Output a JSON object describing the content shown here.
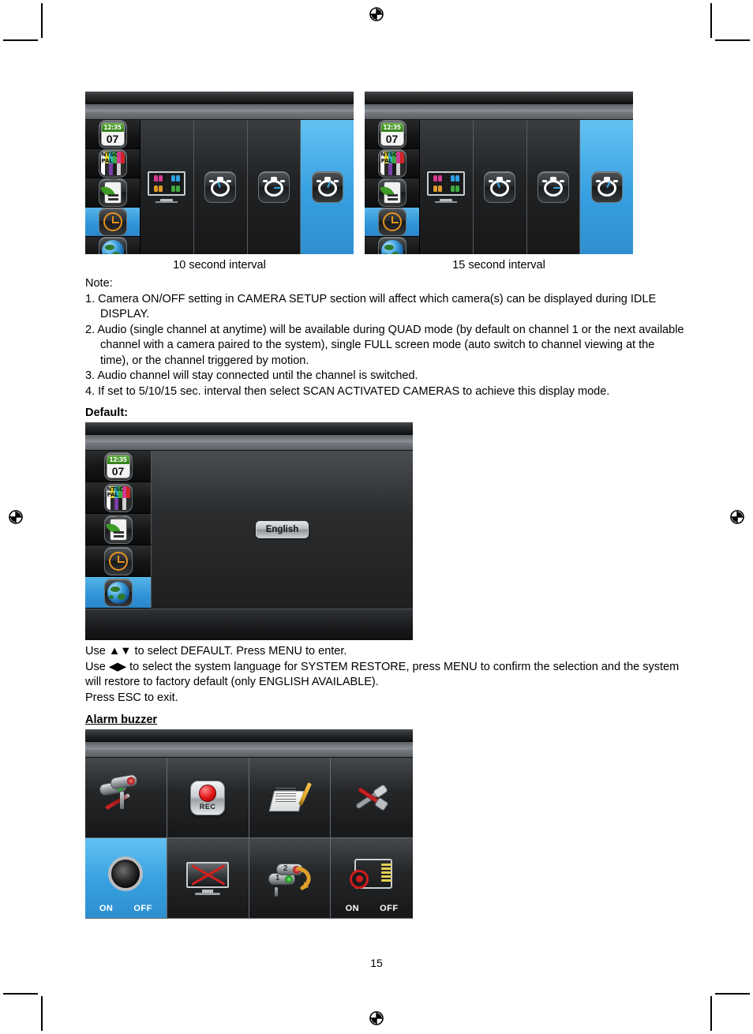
{
  "document": {
    "page_number": "15"
  },
  "idle_display": {
    "panels": [
      {
        "caption": "10 second interval",
        "selected_sidebar_index": 3,
        "selected_column_index": 3,
        "sidebar_icons": [
          "calendar-clock-icon",
          "ntsc-pal-icon",
          "eco-battery-icon",
          "orange-clock-icon",
          "globe-icon"
        ],
        "columns": [
          "quad-monitor-icon",
          "stopwatch-5s-icon",
          "stopwatch-10s-icon",
          "stopwatch-15s-icon"
        ],
        "clock": {
          "time": "12:35",
          "day": "07"
        }
      },
      {
        "caption": "15 second interval",
        "selected_sidebar_index": 3,
        "selected_column_index": 4,
        "sidebar_icons": [
          "calendar-clock-icon",
          "ntsc-pal-icon",
          "eco-battery-icon",
          "orange-clock-icon",
          "globe-icon"
        ],
        "columns": [
          "quad-monitor-icon",
          "stopwatch-5s-icon",
          "stopwatch-10s-icon",
          "stopwatch-15s-icon"
        ],
        "clock": {
          "time": "12:35",
          "day": "07"
        }
      }
    ]
  },
  "note": {
    "heading": "Note:",
    "items": [
      "1. Camera ON/OFF setting in CAMERA SETUP section will affect which camera(s) can be displayed during IDLE DISPLAY.",
      "2. Audio (single channel at anytime) will be available during QUAD mode (by default on channel 1 or the next available channel with a camera paired to the system), single FULL screen mode (auto switch to channel viewing at the time), or the channel triggered by motion.",
      "3. Audio channel will stay connected until the channel is switched.",
      "4. If set to 5/10/15 sec. interval then select SCAN ACTIVATED CAMERAS to achieve this display mode."
    ]
  },
  "default_section": {
    "heading": "Default:",
    "selected_sidebar_index": 4,
    "sidebar_icons": [
      "calendar-clock-icon",
      "ntsc-pal-icon",
      "eco-battery-icon",
      "orange-clock-icon",
      "globe-icon"
    ],
    "language_button": "English",
    "clock": {
      "time": "12:35",
      "day": "07"
    },
    "instructions": [
      "Use ▲▼ to select DEFAULT. Press MENU to enter.",
      "Use ◀▶ to select the system language for SYSTEM RESTORE, press MENU to confirm the selection and the system will restore to factory default (only ENGLISH AVAILABLE).",
      "Press ESC to exit."
    ]
  },
  "alarm_buzzer": {
    "heading": "Alarm buzzer",
    "selected_cell_index": 4,
    "cells": [
      {
        "icon": "camera-setup-icon",
        "label": ""
      },
      {
        "icon": "record-rec-icon",
        "label": ""
      },
      {
        "icon": "event-list-icon",
        "label": ""
      },
      {
        "icon": "system-tools-icon",
        "label": ""
      },
      {
        "icon": "speaker-buzzer-icon",
        "label": "",
        "on": "ON",
        "off": "OFF"
      },
      {
        "icon": "display-off-icon",
        "label": ""
      },
      {
        "icon": "camera-scan-icon",
        "label": ""
      },
      {
        "icon": "sd-card-overwrite-icon",
        "label": "",
        "on": "ON",
        "off": "OFF"
      }
    ]
  },
  "colors": {
    "selection_blue": "#36a0e0",
    "osd_dark": "#1b1b1b",
    "accent_red": "#d41f1f",
    "accent_green": "#3e9b24",
    "accent_orange": "#e8921e"
  }
}
